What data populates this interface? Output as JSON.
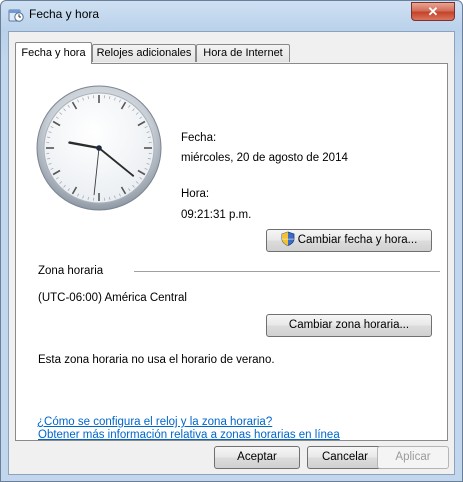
{
  "window": {
    "title": "Fecha y hora",
    "close_label": "✕"
  },
  "tabs": [
    {
      "label": "Fecha y hora",
      "active": true
    },
    {
      "label": "Relojes adicionales",
      "active": false
    },
    {
      "label": "Hora de Internet",
      "active": false
    }
  ],
  "date_section": {
    "date_label": "Fecha:",
    "date_value": "miércoles, 20 de agosto de 2014",
    "time_label": "Hora:",
    "time_value": "09:21:31 p.m.",
    "change_datetime_button": "Cambiar fecha y hora..."
  },
  "clock": {
    "hour": 9,
    "minute": 21,
    "second": 31
  },
  "timezone_section": {
    "heading": "Zona horaria",
    "current_zone": "(UTC-06:00) América Central",
    "change_zone_button": "Cambiar zona horaria...",
    "dst_note": "Esta zona horaria no usa el horario de verano."
  },
  "links": {
    "more_info": "Obtener más información relativa a zonas horarias en línea",
    "how_to": "¿Cómo se configura el reloj y la zona horaria?"
  },
  "footer": {
    "accept": "Aceptar",
    "cancel": "Cancelar",
    "apply": "Aplicar"
  },
  "colors": {
    "link": "#0066cc",
    "title_bar": "#c2d7ee",
    "close_button": "#c4442a"
  },
  "icons": [
    "clock-window-icon",
    "close-icon",
    "uac-shield-icon",
    "analog-clock"
  ]
}
